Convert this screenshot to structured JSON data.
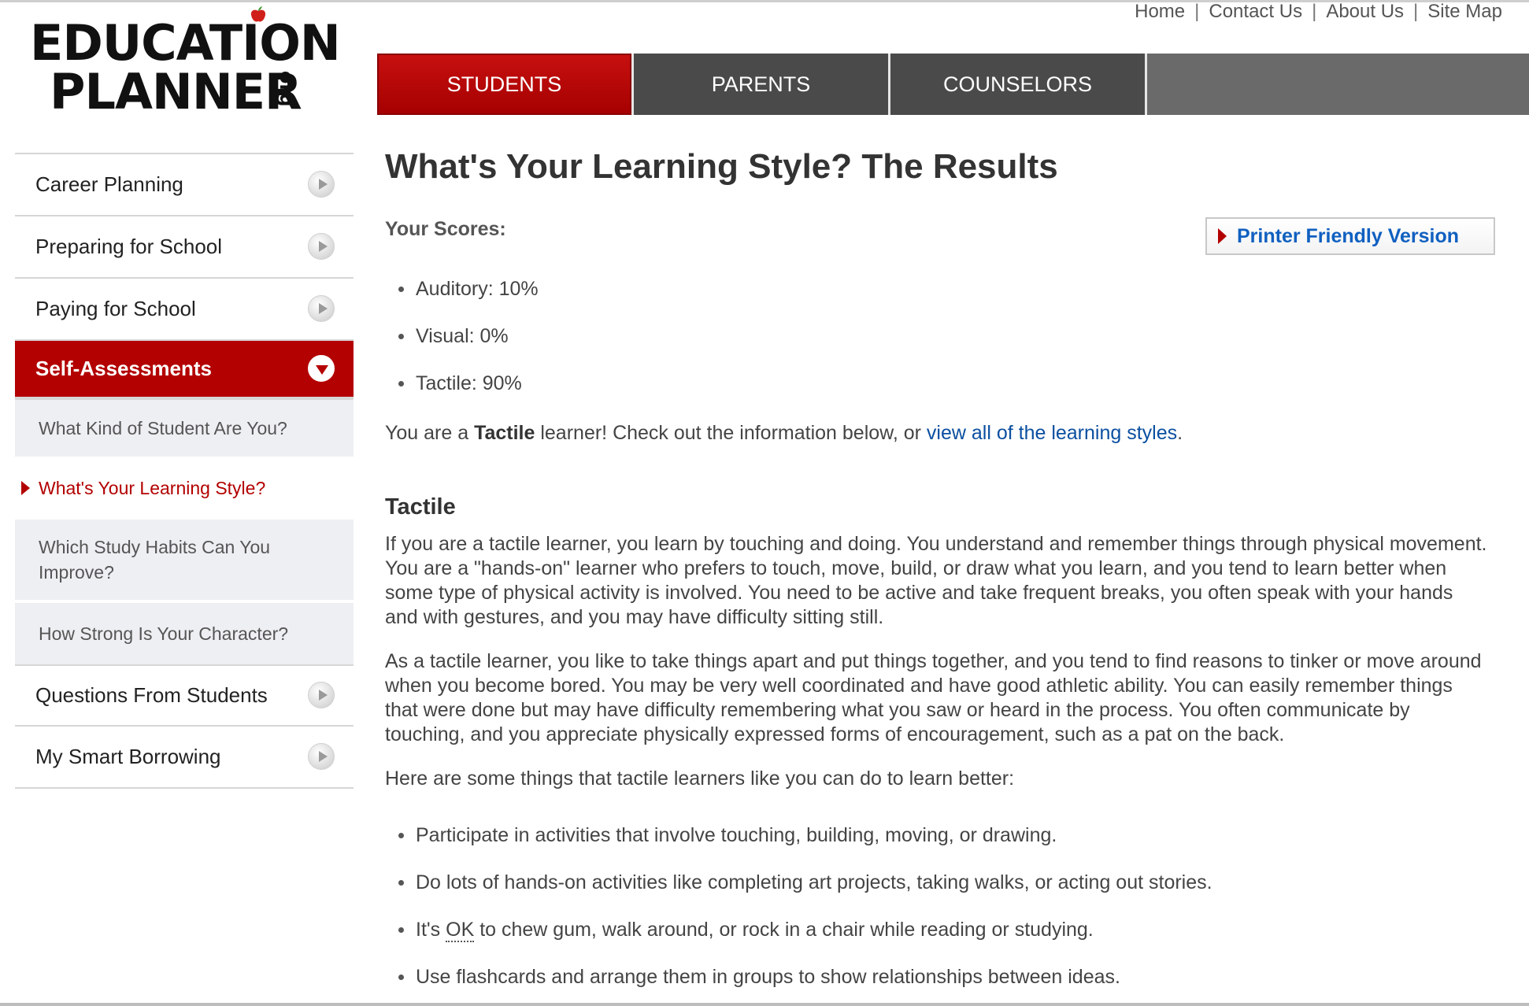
{
  "logo": {
    "line1": "EDUCATION",
    "line2": "PLANNER",
    "suffix": "org",
    "apple_color": "#d0201a",
    "leaf_color": "#3a9a2a"
  },
  "util_links": {
    "home": "Home",
    "contact": "Contact Us",
    "about": "About Us",
    "sitemap": "Site Map",
    "separator": "|"
  },
  "tabs": [
    {
      "label": "STUDENTS",
      "active": true
    },
    {
      "label": "PARENTS",
      "active": false
    },
    {
      "label": "COUNSELORS",
      "active": false
    }
  ],
  "sidebar": {
    "items": [
      {
        "label": "Career Planning"
      },
      {
        "label": "Preparing for School"
      },
      {
        "label": "Paying for School"
      },
      {
        "label": "Self-Assessments"
      }
    ],
    "subitems": [
      {
        "label": "What Kind of Student Are You?"
      },
      {
        "label": "What's Your Learning Style?"
      },
      {
        "label": "Which Study Habits Can You Improve?"
      },
      {
        "label": "How Strong Is Your Character?"
      }
    ],
    "items_after": [
      {
        "label": "Questions From Students"
      },
      {
        "label": "My Smart Borrowing"
      }
    ]
  },
  "main": {
    "title": "What's Your Learning Style? The Results",
    "scores_label": "Your Scores:",
    "printer_button": "Printer Friendly Version",
    "scores": [
      {
        "text": "Auditory: 10%"
      },
      {
        "text": "Visual: 0%"
      },
      {
        "text": "Tactile: 90%"
      }
    ],
    "result_prefix": "You are a ",
    "result_type": "Tactile",
    "result_middle": " learner! Check out the information below, or ",
    "result_link": "view all of the learning styles",
    "result_suffix": ".",
    "section_heading": "Tactile",
    "para1": "If you are a tactile learner, you learn by touching and doing. You understand and remember things through physical movement. You are a \"hands-on\" learner who prefers to touch, move, build, or draw what you learn, and you tend to learn better when some type of physical activity is involved. You need to be active and take frequent breaks, you often speak with your hands and with gestures, and you may have difficulty sitting still.",
    "para2": "As a tactile learner, you like to take things apart and put things together, and you tend to find reasons to tinker or move around when you become bored. You may be very well coordinated and have good athletic ability. You can easily remember things that were done but may have difficulty remembering what you saw or heard in the process. You often communicate by touching, and you appreciate physically expressed forms of encouragement, such as a pat on the back.",
    "para3": "Here are some things that tactile learners like you can do to learn better:",
    "tips": [
      {
        "text": "Participate in activities that involve touching, building, moving, or drawing."
      },
      {
        "text": "Do lots of hands-on activities like completing art projects, taking walks, or acting out stories."
      },
      {
        "prefix": "It's ",
        "abbr": "OK",
        "suffix": " to chew gum, walk around, or rock in a chair while reading or studying."
      },
      {
        "text": "Use flashcards and arrange them in groups to show relationships between ideas."
      }
    ]
  },
  "colors": {
    "accent_red": "#b30000",
    "tab_dark": "#4a4a4a",
    "link_blue": "#0b4fa0",
    "button_link_blue": "#1060c0"
  }
}
